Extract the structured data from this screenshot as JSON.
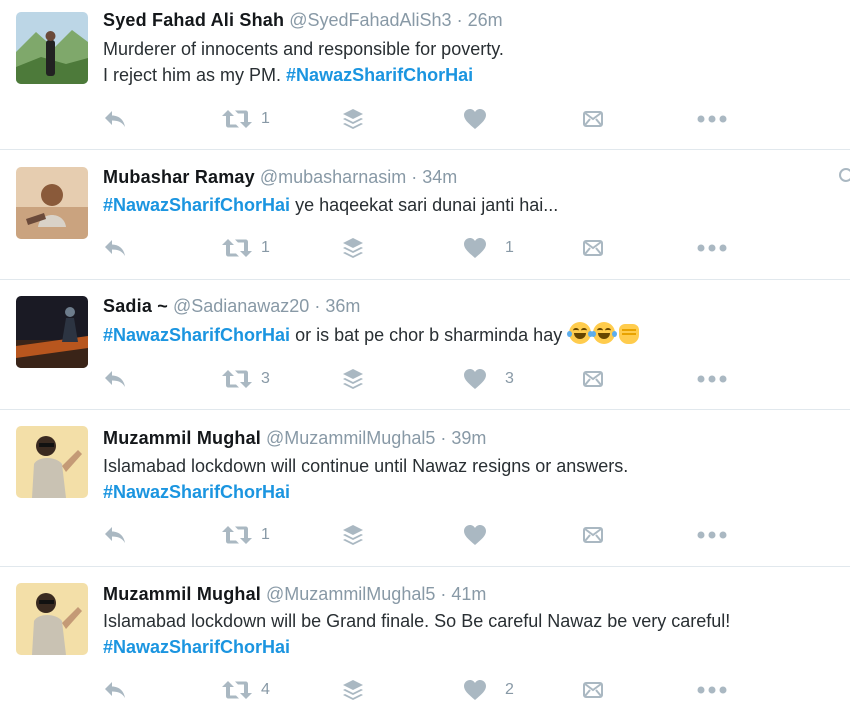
{
  "colors": {
    "hashtag": "#1b95e0",
    "name": "#14171a",
    "meta": "#8899a6",
    "icon": "#aab8c2"
  },
  "tweets": [
    {
      "name": "Syed Fahad Ali Shah",
      "handle": "@SyedFahadAliSh3",
      "sep": "·",
      "time": "26m",
      "lines": [
        {
          "text": "Murderer of innocents  and responsible for poverty.",
          "tag": ""
        },
        {
          "text": "I reject him as my PM. ",
          "tag": "#NawazSharifChorHai"
        }
      ],
      "retweets": "1",
      "likes": ""
    },
    {
      "name": "Mubashar Ramay",
      "handle": "@mubasharnasim",
      "sep": "·",
      "time": "34m",
      "lines": [
        {
          "tag": "#NawazSharifChorHai",
          "text": " ye haqeekat sari dunai janti hai..."
        }
      ],
      "retweets": "1",
      "likes": "1"
    },
    {
      "name": "Sadia ~",
      "handle": "@Sadianawaz20",
      "sep": "·",
      "time": "36m",
      "lines": [
        {
          "tag": "#NawazSharifChorHai",
          "text": " or is bat pe chor b sharminda hay "
        }
      ],
      "emojis": [
        "face-with-tears-of-joy-emoji",
        "face-with-tears-of-joy-emoji",
        "oncoming-fist-emoji"
      ],
      "retweets": "3",
      "likes": "3"
    },
    {
      "name": "Muzammil Mughal",
      "handle": "@MuzammilMughal5",
      "sep": "·",
      "time": "39m",
      "lines": [
        {
          "text": "Islamabad lockdown will continue until Nawaz resigns or answers.",
          "tag": ""
        },
        {
          "text": " ",
          "tag": "#NawazSharifChorHai"
        }
      ],
      "retweets": "1",
      "likes": ""
    },
    {
      "name": "Muzammil Mughal",
      "handle": "@MuzammilMughal5",
      "sep": "·",
      "time": "41m",
      "lines": [
        {
          "text": "Islamabad lockdown will be Grand finale. So Be careful Nawaz be very careful!",
          "tag": ""
        },
        {
          "text": "",
          "tag": "#NawazSharifChorHai"
        }
      ],
      "retweets": "4",
      "likes": "2"
    }
  ],
  "icons": {
    "reply": "reply-icon",
    "retweet": "retweet-icon",
    "stack": "stack-icon",
    "like": "heart-icon",
    "dm": "direct-message-icon",
    "more": "more-icon"
  }
}
